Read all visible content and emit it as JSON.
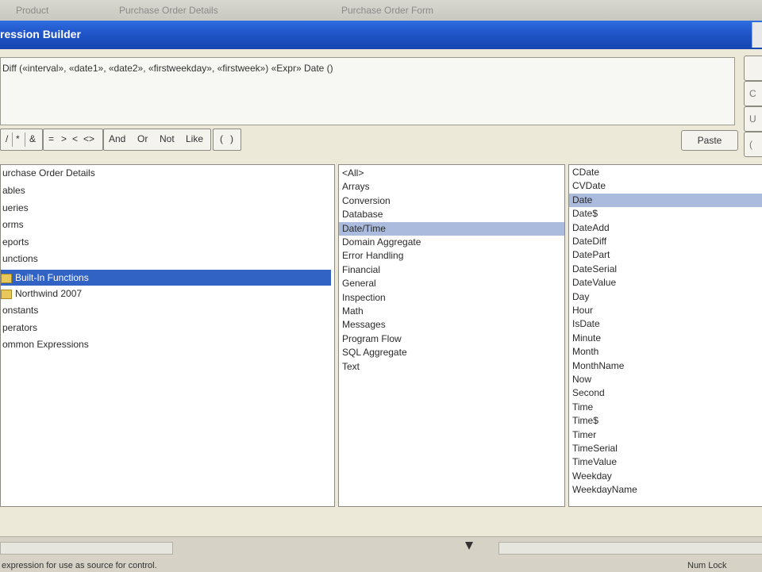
{
  "background_tabs": [
    "Product",
    "Purchase Order Details",
    "Purchase Order Form"
  ],
  "window": {
    "title": "ression Builder"
  },
  "expression": "Diff («interval», «date1», «date2», «firstweekday», «firstweek») «Expr» Date ()",
  "side_buttons": [
    "",
    "C",
    "U",
    "("
  ],
  "operators": [
    "/",
    "*",
    "&",
    "=",
    ">",
    "<",
    "<>",
    "And",
    "Or",
    "Not",
    "Like",
    "(",
    ")"
  ],
  "paste_label": "Paste",
  "left_pane": {
    "items": [
      {
        "label": "urchase Order Details"
      },
      {
        "label": "ables"
      },
      {
        "label": "ueries"
      },
      {
        "label": "orms"
      },
      {
        "label": "eports"
      },
      {
        "label": "unctions"
      },
      {
        "label": "Built-In Functions",
        "folder": true,
        "selected": true
      },
      {
        "label": "Northwind 2007",
        "folder": true
      },
      {
        "label": "onstants"
      },
      {
        "label": "perators"
      },
      {
        "label": "ommon Expressions"
      }
    ]
  },
  "middle_pane": {
    "items": [
      "<All>",
      "Arrays",
      "Conversion",
      "Database",
      "Date/Time",
      "Domain Aggregate",
      "Error Handling",
      "Financial",
      "General",
      "Inspection",
      "Math",
      "Messages",
      "Program Flow",
      "SQL Aggregate",
      "Text"
    ],
    "selected": "Date/Time"
  },
  "right_pane": {
    "items": [
      "CDate",
      "CVDate",
      "Date",
      "Date$",
      "DateAdd",
      "DateDiff",
      "DatePart",
      "DateSerial",
      "DateValue",
      "Day",
      "Hour",
      "IsDate",
      "Minute",
      "Month",
      "MonthName",
      "Now",
      "Second",
      "Time",
      "Time$",
      "Timer",
      "TimeSerial",
      "TimeValue",
      "Weekday",
      "WeekdayName"
    ],
    "selected": "Date"
  },
  "status": {
    "text": "expression for use as source for control.",
    "numlock": "Num Lock"
  },
  "colors": {
    "title_bar": "#1f55c9",
    "selection": "#3163c5",
    "selection_inactive": "#aabbdd"
  }
}
